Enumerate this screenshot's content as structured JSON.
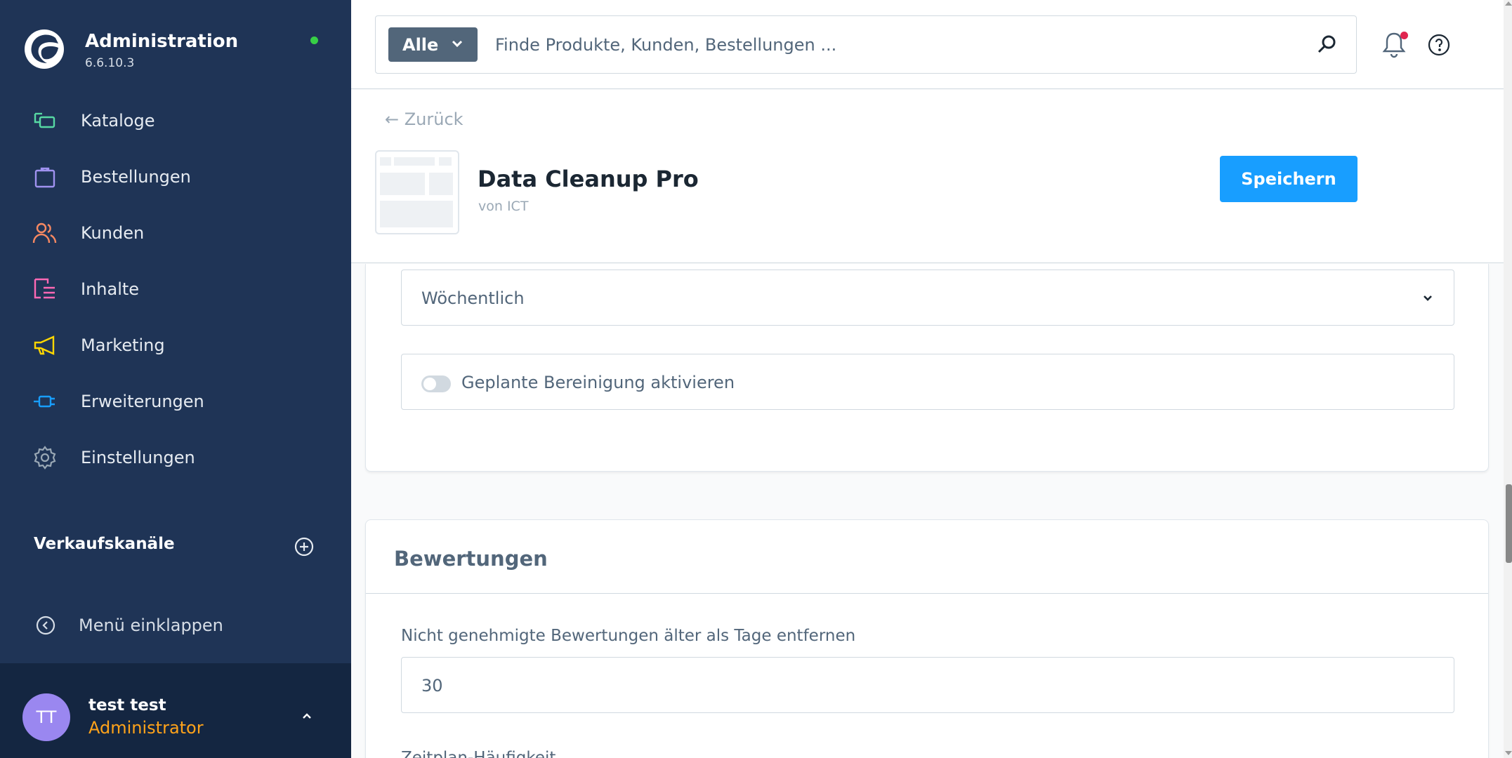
{
  "sidebar": {
    "app_title": "Administration",
    "version": "6.6.10.3",
    "items": [
      {
        "label": "Kataloge",
        "icon": "catalog-icon",
        "color": "#57d9a3"
      },
      {
        "label": "Bestellungen",
        "icon": "shopping-bag-icon",
        "color": "#a092f0"
      },
      {
        "label": "Kunden",
        "icon": "users-icon",
        "color": "#f88962"
      },
      {
        "label": "Inhalte",
        "icon": "content-list-icon",
        "color": "#ff68b4"
      },
      {
        "label": "Marketing",
        "icon": "megaphone-icon",
        "color": "#ffd700"
      },
      {
        "label": "Erweiterungen",
        "icon": "plug-icon",
        "color": "#189eff"
      },
      {
        "label": "Einstellungen",
        "icon": "gear-icon",
        "color": "#9aa8b5"
      }
    ],
    "sales_channels_label": "Verkaufskanäle",
    "collapse_label": "Menü einklappen",
    "user": {
      "initials": "TT",
      "name": "test test",
      "role": "Administrator"
    }
  },
  "search": {
    "type_label": "Alle",
    "placeholder": "Finde Produkte, Kunden, Bestellungen ..."
  },
  "header": {
    "back_label": "← Zurück",
    "title": "Data Cleanup Pro",
    "vendor": "von ICT",
    "save_label": "Speichern"
  },
  "schedule_card": {
    "frequency_value": "Wöchentlich",
    "toggle_label": "Geplante Bereinigung aktivieren",
    "toggle_on": false
  },
  "reviews_card": {
    "title": "Bewertungen",
    "days_label": "Nicht genehmigte Bewertungen älter als Tage entfernen",
    "days_value": "30",
    "schedule_label": "Zeitplan-Häufigkeit"
  },
  "colors": {
    "sidebar_bg": "#1f3456",
    "user_bg": "#142641",
    "accent": "#189eff",
    "status_online": "#37d046",
    "role_color": "#ffa31a",
    "notification": "#e0254f"
  }
}
